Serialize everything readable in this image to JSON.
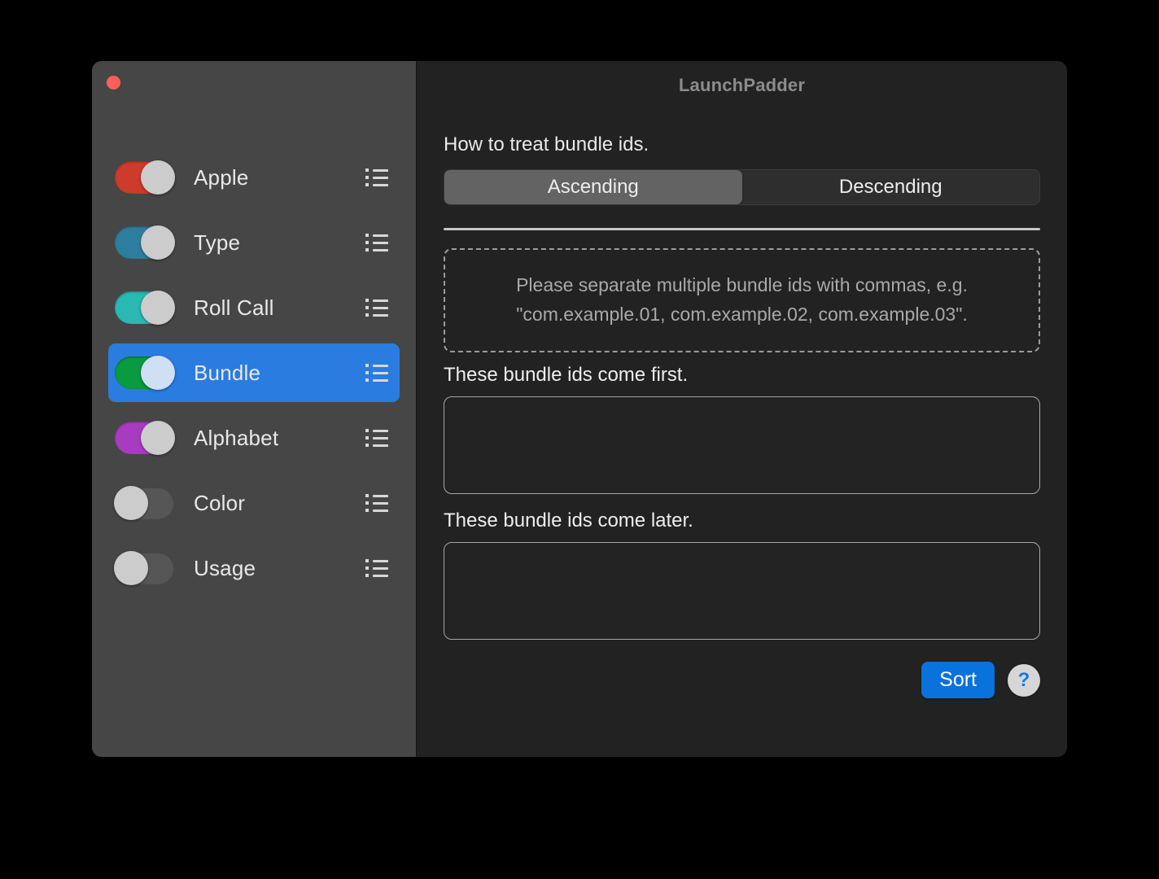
{
  "window": {
    "title": "LaunchPadder",
    "close_button_color": "#ff5f57"
  },
  "sidebar": {
    "items": [
      {
        "label": "Apple",
        "toggle_on": true,
        "track_color": "#cc3b2b",
        "knob_color": "#cccccc",
        "selected": false,
        "list_icon": "list-icon"
      },
      {
        "label": "Type",
        "toggle_on": true,
        "track_color": "#2d7e9e",
        "knob_color": "#cccccc",
        "selected": false,
        "list_icon": "list-icon"
      },
      {
        "label": "Roll Call",
        "toggle_on": true,
        "track_color": "#29b8b2",
        "knob_color": "#cccccc",
        "selected": false,
        "list_icon": "list-icon"
      },
      {
        "label": "Bundle",
        "toggle_on": true,
        "track_color": "#0a9a3f",
        "knob_color": "#cfe0f5",
        "selected": true,
        "list_icon": "list-icon"
      },
      {
        "label": "Alphabet",
        "toggle_on": true,
        "track_color": "#a83cc0",
        "knob_color": "#cccccc",
        "selected": false,
        "list_icon": "list-icon"
      },
      {
        "label": "Color",
        "toggle_on": false,
        "track_color": "#565656",
        "knob_color": "#cccccc",
        "selected": false,
        "list_icon": "list-icon"
      },
      {
        "label": "Usage",
        "toggle_on": false,
        "track_color": "#565656",
        "knob_color": "#cccccc",
        "selected": false,
        "list_icon": "list-icon"
      }
    ],
    "selection_color": "#2a7ce0"
  },
  "main": {
    "treat_label": "How to treat bundle ids.",
    "segmented": {
      "options": [
        "Ascending",
        "Descending"
      ],
      "selected": "Ascending",
      "ascending_label": "Ascending",
      "descending_label": "Descending"
    },
    "hint": "Please separate multiple bundle ids with commas, e.g. \"com.example.01, com.example.02, com.example.03\".",
    "first_field": {
      "label": "These bundle ids come first.",
      "value": "",
      "placeholder": ""
    },
    "later_field": {
      "label": "These bundle ids come later.",
      "value": "",
      "placeholder": ""
    },
    "sort_button": "Sort",
    "help_button": "?",
    "accent_color": "#0a72dd"
  }
}
